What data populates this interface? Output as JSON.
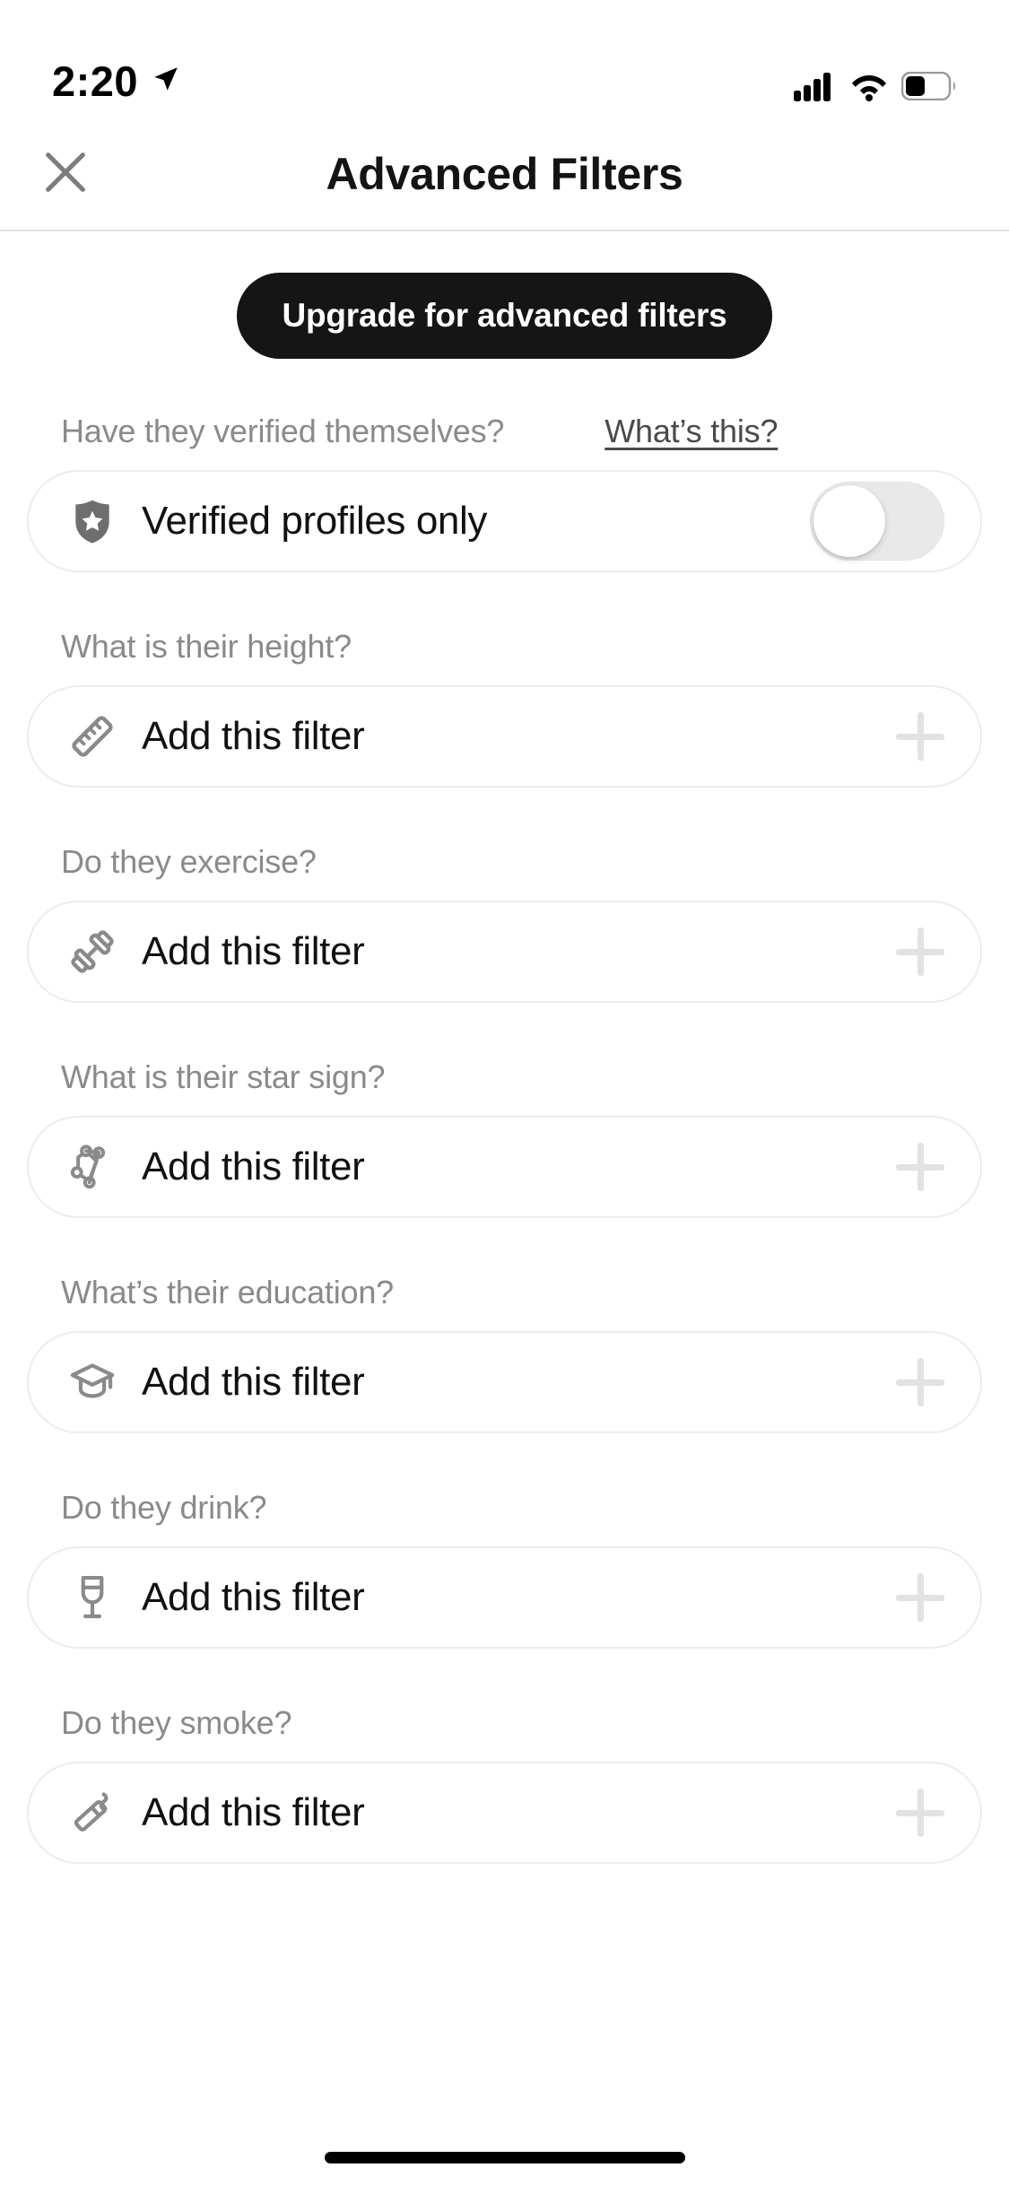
{
  "status_bar": {
    "time": "2:20",
    "location_icon": "location-arrow-icon",
    "signal_icon": "cellular-signal-icon",
    "wifi_icon": "wifi-icon",
    "battery_icon": "battery-icon",
    "battery_level_pct": 40
  },
  "header": {
    "title": "Advanced Filters",
    "close_icon": "close-icon"
  },
  "upgrade": {
    "label": "Upgrade for advanced filters"
  },
  "verified_section": {
    "label": "Have they verified themselves?",
    "help_link": "What’s this?",
    "card_label": "Verified profiles only",
    "icon": "shield-star-icon",
    "toggle_on": false
  },
  "filters": [
    {
      "question": "What is their height?",
      "card_label": "Add this filter",
      "icon": "ruler-icon"
    },
    {
      "question": "Do they exercise?",
      "card_label": "Add this filter",
      "icon": "dumbbell-icon"
    },
    {
      "question": "What is their star sign?",
      "card_label": "Add this filter",
      "icon": "constellation-icon"
    },
    {
      "question": "What’s their education?",
      "card_label": "Add this filter",
      "icon": "graduation-cap-icon"
    },
    {
      "question": "Do they drink?",
      "card_label": "Add this filter",
      "icon": "wine-glass-icon"
    },
    {
      "question": "Do they smoke?",
      "card_label": "Add this filter",
      "icon": "cigarette-icon"
    }
  ],
  "colors": {
    "accent_dark": "#151515",
    "label_gray": "#8a8a8a",
    "link_gray": "#4a4a4a",
    "card_border": "#ececec",
    "plus_gray": "#e2e2e2",
    "icon_gray": "#6e6e6e",
    "toggle_track": "#e9e9e9"
  }
}
